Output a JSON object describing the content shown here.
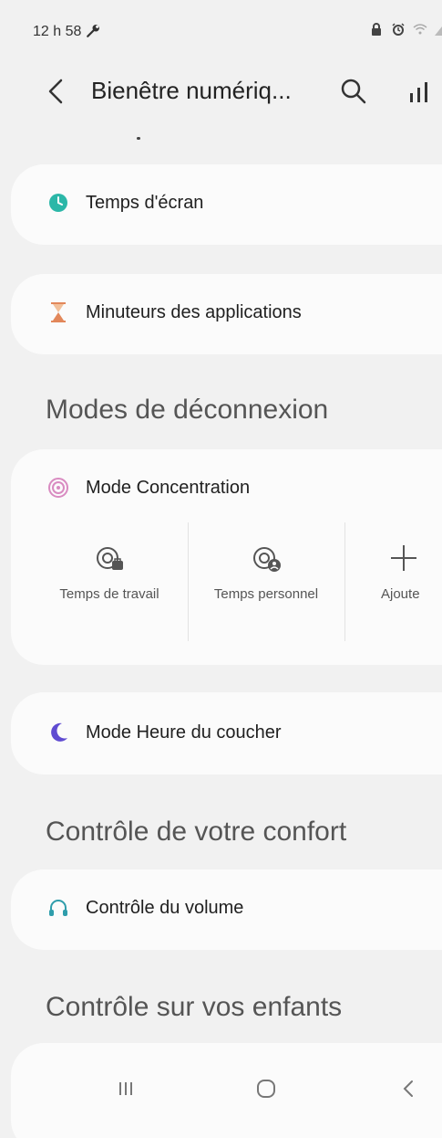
{
  "status_bar": {
    "time": "12 h 58"
  },
  "app_bar": {
    "title": "Bienêtre numériq..."
  },
  "cards": {
    "screen_time": "Temps d'écran",
    "app_timers": "Minuteurs des applications",
    "focus_mode": "Mode Concentration",
    "bedtime_mode": "Mode Heure du coucher",
    "volume_control": "Contrôle du volume"
  },
  "sections": {
    "disconnect": "Modes de déconnexion",
    "comfort": "Contrôle de votre confort",
    "children": "Contrôle sur vos enfants"
  },
  "focus_items": [
    {
      "label": "Temps de travail"
    },
    {
      "label": "Temps personnel"
    },
    {
      "label": "Ajoute"
    }
  ],
  "colors": {
    "screen_time_icon": "#2bb7a8",
    "timer_icon": "#e2875a",
    "focus_icon": "#d98bc1",
    "bedtime_icon": "#5f4bd1",
    "volume_icon": "#2f9dab"
  }
}
